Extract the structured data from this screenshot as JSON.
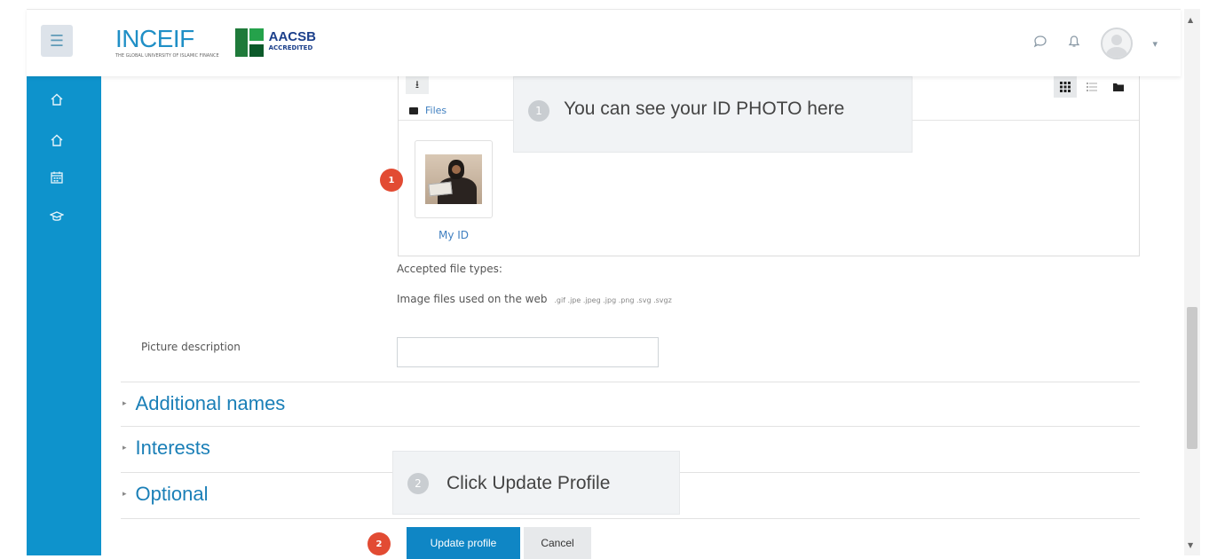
{
  "header": {
    "menu_icon": "hamburger-icon",
    "logo_inceif": "INCEIF",
    "logo_inceif_sub": "THE GLOBAL UNIVERSITY OF ISLAMIC FINANCE",
    "logo_aacsb": "AACSB",
    "logo_aacsb_sub": "ACCREDITED",
    "icons": [
      "message-icon",
      "bell-icon",
      "user-avatar",
      "chevron-down-icon"
    ]
  },
  "sidebar": {
    "items": [
      {
        "icon": "home-icon"
      },
      {
        "icon": "home-icon"
      },
      {
        "icon": "calendar-icon"
      },
      {
        "icon": "graduation-cap-icon"
      }
    ]
  },
  "filepicker": {
    "breadcrumb": "Files",
    "file_name": "My ID",
    "view_modes": [
      "grid-view-icon",
      "list-view-icon",
      "folder-view-icon"
    ]
  },
  "callouts": {
    "first": {
      "number": "1",
      "text": "You can see your ID PHOTO here"
    },
    "second": {
      "number": "2",
      "text": "Click Update Profile"
    }
  },
  "badges": {
    "first": "1",
    "second": "2"
  },
  "form": {
    "accepted_label": "Accepted file types:",
    "filetypes_label": "Image files used on the web",
    "filetypes_ext": ".gif .jpe .jpeg .jpg .png .svg .svgz",
    "picture_description_label": "Picture description",
    "picture_description_value": ""
  },
  "sections": [
    "Additional names",
    "Interests",
    "Optional"
  ],
  "actions": {
    "update_label": "Update profile",
    "cancel_label": "Cancel"
  },
  "colors": {
    "sidebar": "#0e93cc",
    "accent": "#1a7fb7",
    "primary_button": "#0f86c5",
    "badge": "#e24b33"
  }
}
